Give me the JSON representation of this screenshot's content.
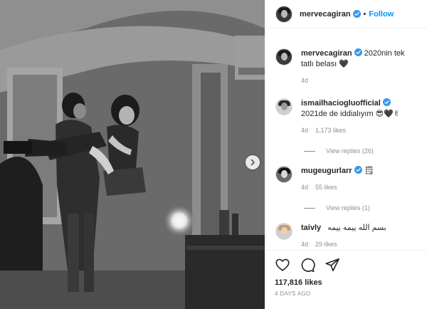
{
  "post": {
    "author": "mervecagiran",
    "follow_label": "Follow",
    "separator": "•",
    "caption_text": "2020nin tek tatlı belası 🖤",
    "caption_time": "4d"
  },
  "comments": [
    {
      "user": "ismailhaciogluofficial",
      "text": "2021de de iddialıyım 😎🖤✌",
      "time": "4d",
      "likes": "1,173 likes",
      "replies": "View replies (26)"
    },
    {
      "user": "mugeugurlarr",
      "text": "🗒",
      "time": "4d",
      "likes": "55 likes",
      "replies": "View replies (1)"
    },
    {
      "user": "taivly",
      "text": "بسم الله ییمه ییمه",
      "time": "4d",
      "likes": "29 likes"
    }
  ],
  "footer": {
    "likes_count": "117,816 likes",
    "date": "4 DAYS AGO"
  },
  "icons": {
    "verified": "verified-badge-icon",
    "next": "chevron-right-icon",
    "like": "heart-icon",
    "comment": "comment-bubble-icon",
    "share": "paper-plane-icon"
  },
  "colors": {
    "accent": "#0095f6",
    "muted": "#8e8e8e"
  }
}
